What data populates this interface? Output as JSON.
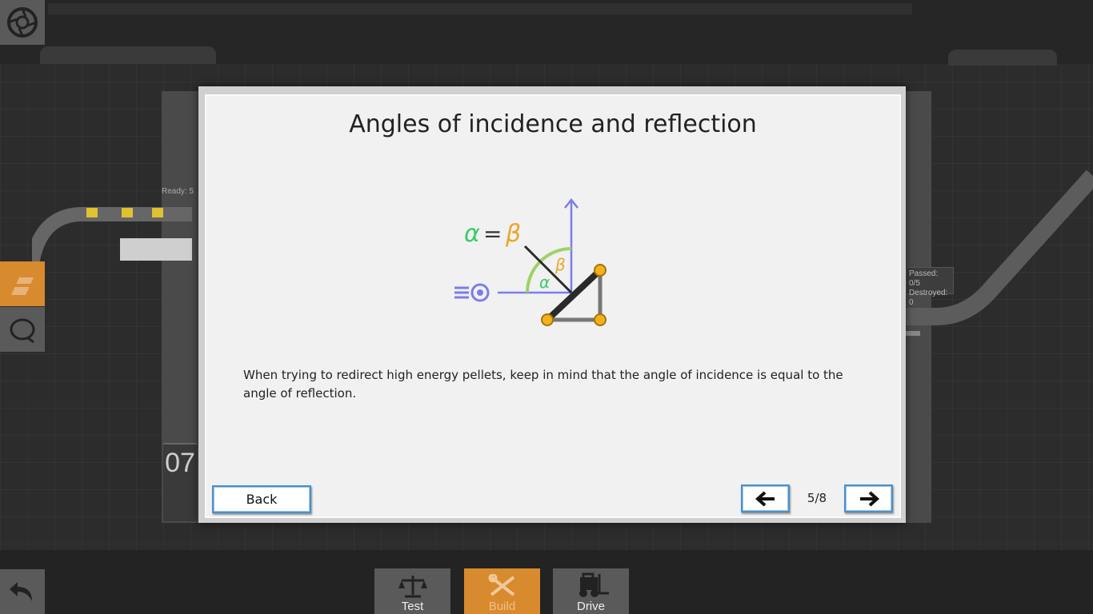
{
  "dialog": {
    "title": "Angles of incidence and reflection",
    "body": "When trying to redirect high energy pellets, keep in mind that the angle of incidence is equal to the angle of reflection.",
    "back_label": "Back",
    "page_indicator": "5/8",
    "prev_icon": "arrow-left-icon",
    "next_icon": "arrow-right-icon"
  },
  "diagram": {
    "equation_alpha": "α",
    "equation_equals": "=",
    "equation_beta": "β",
    "angle_alpha_label": "α",
    "angle_beta_label": "β",
    "colors": {
      "alpha": "#3ec96a",
      "beta": "#e8a82a",
      "arrow": "#7b7ee8",
      "arc": "#9fd06a",
      "joint": "#f2b21f",
      "beam": "#2a2a2a"
    }
  },
  "background": {
    "ready_sign": "Ready: 5",
    "stats_passed": "Passed: 0/5",
    "stats_destroyed": "Destroyed: 0",
    "level_number": "07"
  },
  "toolbar": {
    "test_label": "Test",
    "build_label": "Build",
    "drive_label": "Drive",
    "active_color": "#d88a2e"
  },
  "sidebar": {
    "icons": [
      "portal-icon",
      "edit-icon",
      "loop-icon",
      "undo-icon"
    ]
  }
}
